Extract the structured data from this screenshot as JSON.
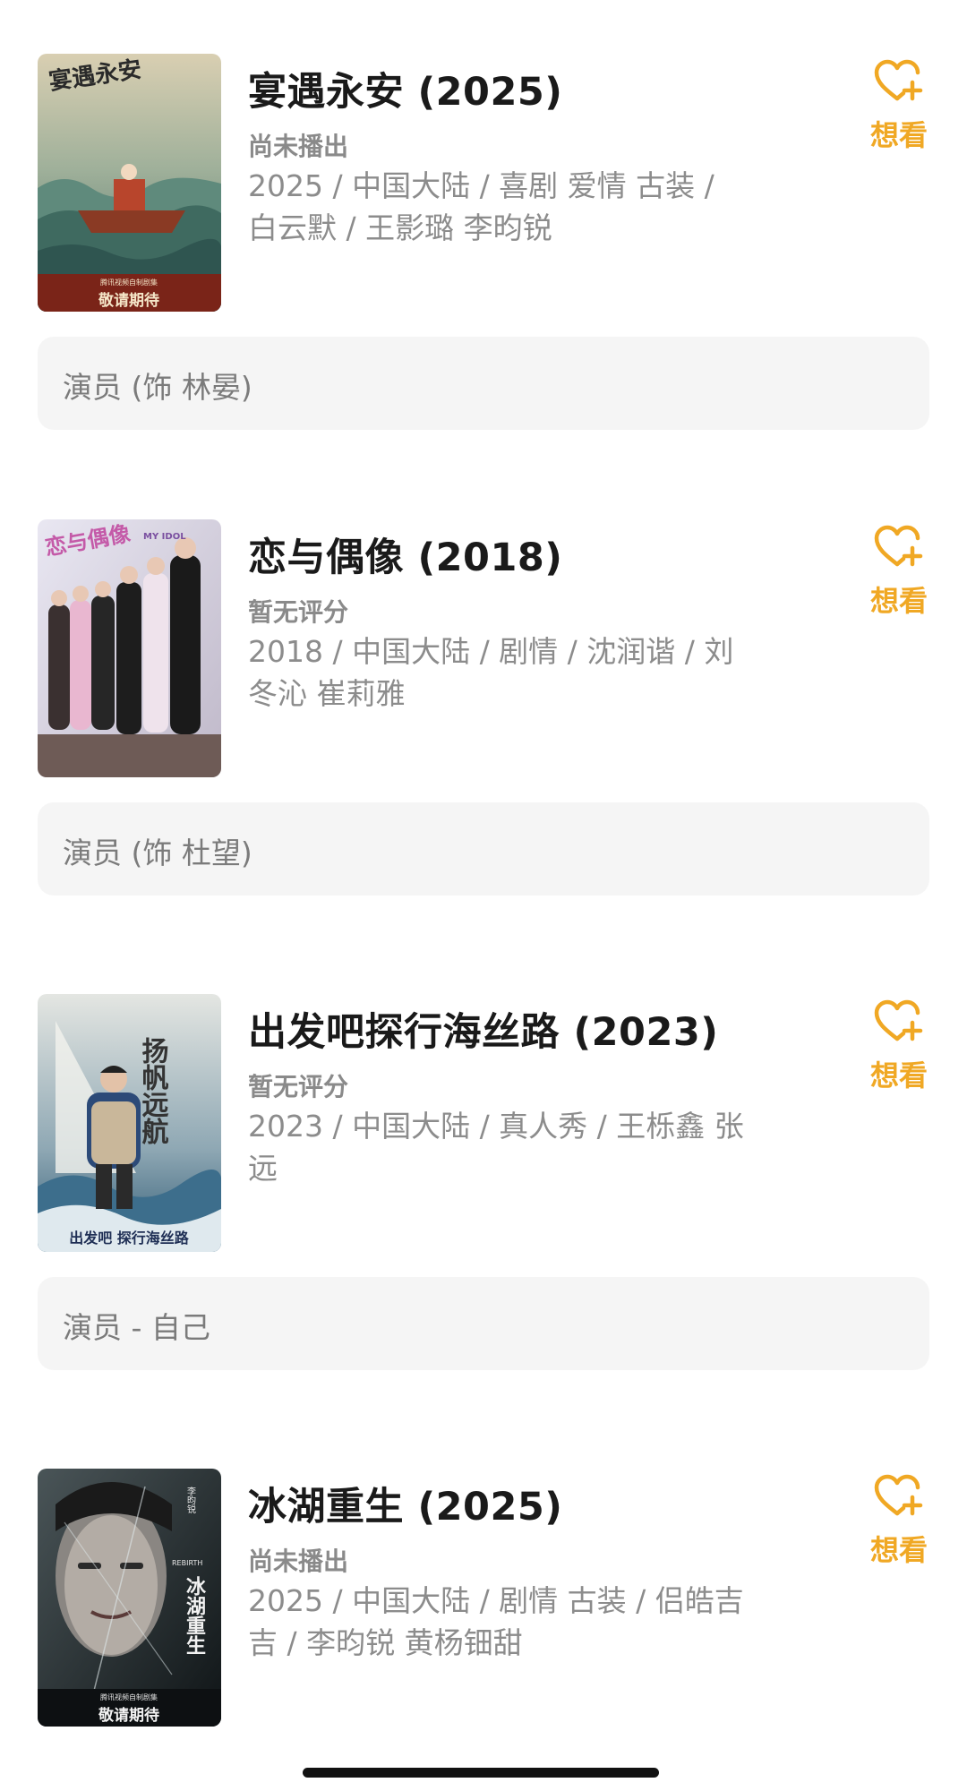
{
  "items": [
    {
      "title": "宴遇永安 (2025)",
      "status": "尚未播出",
      "meta": "2025 / 中国大陆 / 喜剧 爱情 古装 / 白云默 / 王影璐 李昀锐",
      "want_label": "想看",
      "role": "演员 (饰 林晏)",
      "poster": {
        "calligraphy": "宴遇永安",
        "caption": "敬请期待",
        "small_caption": "腾讯视频自制剧集"
      }
    },
    {
      "title": "恋与偶像 (2018)",
      "status": "暂无评分",
      "meta": "2018 / 中国大陆 / 剧情 / 沈润谐 / 刘冬沁 崔莉雅",
      "want_label": "想看",
      "role": "演员 (饰 杜望)",
      "poster": {
        "calligraphy": "恋与偶像",
        "small_caption": "MY IDOL"
      }
    },
    {
      "title": "出发吧探行海丝路 (2023)",
      "status": "暂无评分",
      "meta": "2023 / 中国大陆 / 真人秀 / 王栎鑫 张远",
      "want_label": "想看",
      "role": "演员 - 自己",
      "poster": {
        "calligraphy": "扬帆远航",
        "bottom_text": "出发吧 探行海丝路"
      }
    },
    {
      "title": "冰湖重生 (2025)",
      "status": "尚未播出",
      "meta": "2025 / 中国大陆 / 剧情 古装 / 侣皓吉吉 / 李昀锐 黄杨钿甜",
      "want_label": "想看",
      "poster": {
        "calligraphy": "冰湖重生",
        "caption": "敬请期待",
        "small_caption": "腾讯视频自制剧集",
        "corner_text": "李昀锐",
        "latin": "REBIRTH"
      }
    }
  ],
  "colors": {
    "accent": "#f0a824",
    "muted": "#8c8c8c",
    "role_bg": "#f5f5f5"
  },
  "icons": {
    "want": "heart-plus-icon"
  }
}
